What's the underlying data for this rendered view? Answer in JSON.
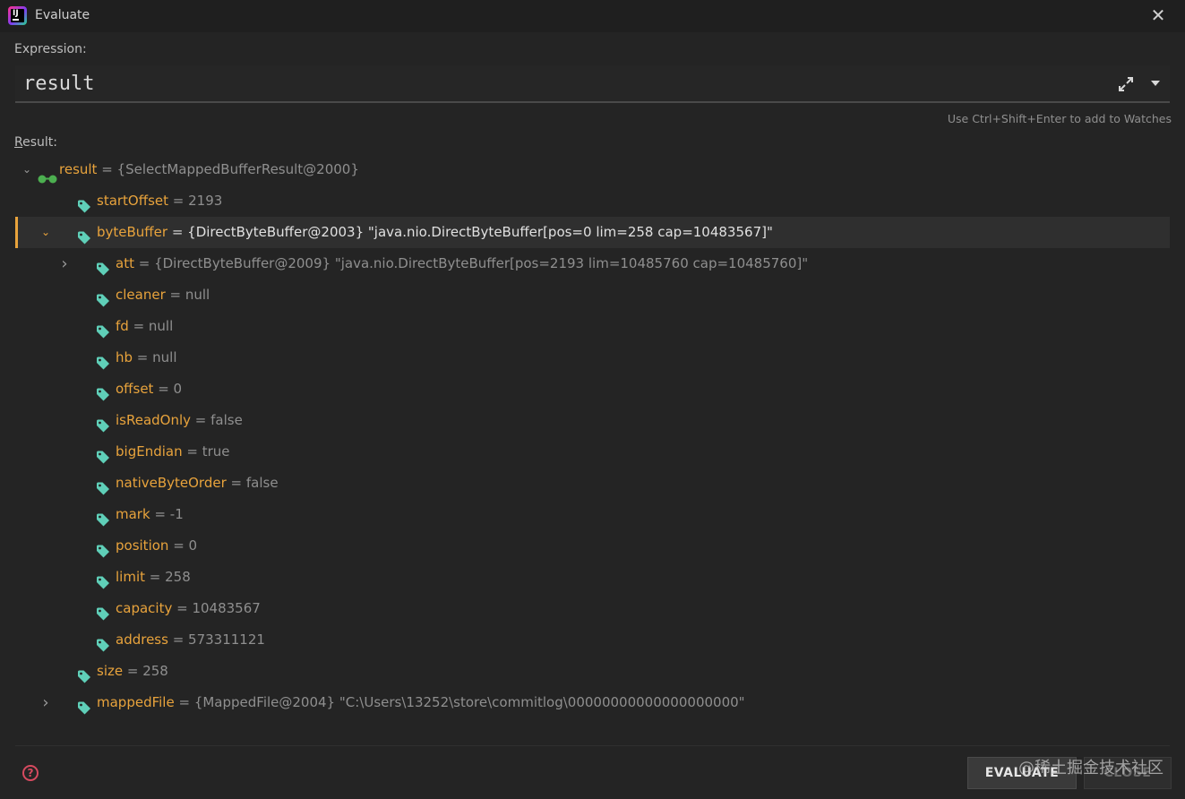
{
  "window": {
    "title": "Evaluate",
    "close_symbol": "✕"
  },
  "expression": {
    "label": "Expression:",
    "value": "result",
    "hint": "Use Ctrl+Shift+Enter to add to Watches"
  },
  "result": {
    "label_first": "R",
    "label_rest": "esult:",
    "rows": [
      {
        "name": "result",
        "value": "{SelectMappedBufferResult@2000}"
      },
      {
        "name": "startOffset",
        "value": "2193"
      },
      {
        "name": "byteBuffer",
        "value": "{DirectByteBuffer@2003} \"java.nio.DirectByteBuffer[pos=0 lim=258 cap=10483567]\""
      },
      {
        "name": "att",
        "value": "{DirectByteBuffer@2009} \"java.nio.DirectByteBuffer[pos=2193 lim=10485760 cap=10485760]\""
      },
      {
        "name": "cleaner",
        "value": "null"
      },
      {
        "name": "fd",
        "value": "null"
      },
      {
        "name": "hb",
        "value": "null"
      },
      {
        "name": "offset",
        "value": "0"
      },
      {
        "name": "isReadOnly",
        "value": "false"
      },
      {
        "name": "bigEndian",
        "value": "true"
      },
      {
        "name": "nativeByteOrder",
        "value": "false"
      },
      {
        "name": "mark",
        "value": "-1"
      },
      {
        "name": "position",
        "value": "0"
      },
      {
        "name": "limit",
        "value": "258"
      },
      {
        "name": "capacity",
        "value": "10483567"
      },
      {
        "name": "address",
        "value": "573311121"
      },
      {
        "name": "size",
        "value": "258"
      },
      {
        "name": "mappedFile",
        "value": "{MappedFile@2004} \"C:\\Users\\13252\\store\\commitlog\\00000000000000000000\""
      }
    ]
  },
  "buttons": {
    "evaluate": "EVALUATE",
    "close": "CLOSE",
    "help": "?"
  },
  "watermark": "@稀土掘金技术社区",
  "colors": {
    "accent": "#e8a33c",
    "tag": "#5fcfb8",
    "background": "#242424"
  },
  "icons": [
    "app-icon",
    "close-icon",
    "expand-icon",
    "history-dropdown-icon",
    "watch-glasses-icon",
    "field-tag-icon",
    "help-icon"
  ]
}
